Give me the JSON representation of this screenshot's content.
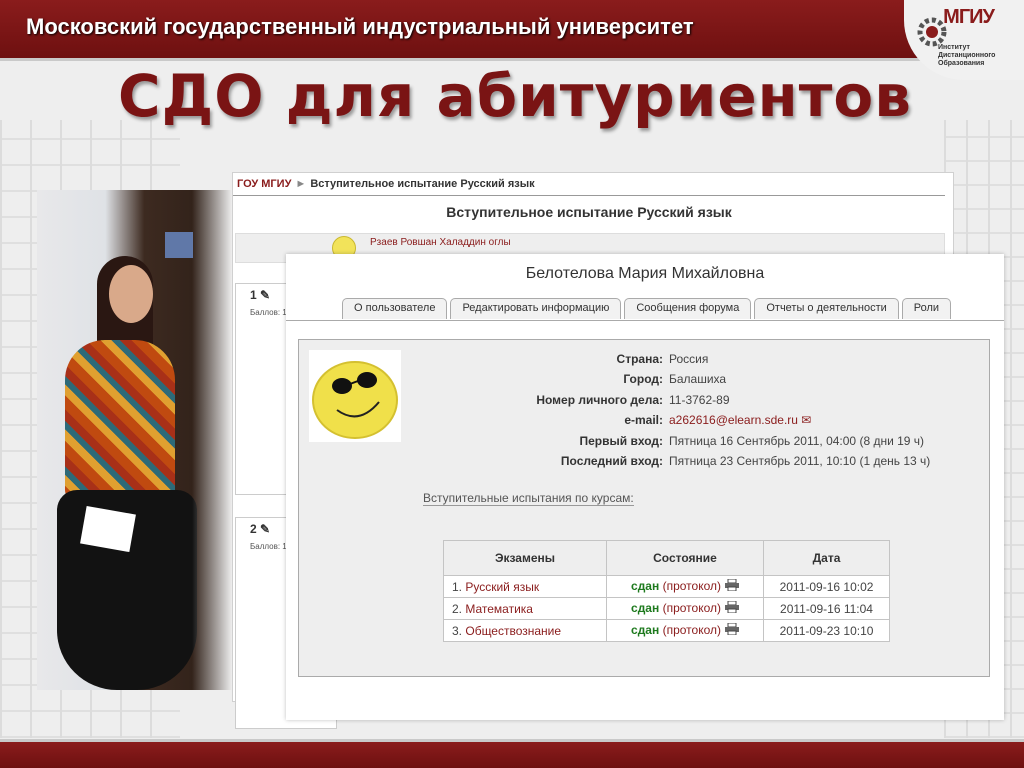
{
  "header": {
    "university": "Московский государственный индустриальный университет",
    "logo_abbr": "МГИУ",
    "logo_lines": [
      "Институт",
      "Дистанционного",
      "Образования"
    ]
  },
  "slide_title": "СДО для абитуриентов",
  "back_window": {
    "breadcrumb_root": "ГОУ МГИУ",
    "breadcrumb_sep": "►",
    "breadcrumb_current": "Вступительное испытание Русский язык",
    "title": "Вступительное испытание Русский язык",
    "student_name": "Рзаев Ровшан Халаддин оглы",
    "questions": [
      {
        "number": "1",
        "score_label": "Баллов: 1"
      },
      {
        "number": "2",
        "score_label": "Баллов: 1"
      }
    ]
  },
  "profile_window": {
    "title": "Белотелова Мария Михайловна",
    "tabs": [
      "О пользователе",
      "Редактировать информацию",
      "Сообщения форума",
      "Отчеты о деятельности",
      "Роли"
    ],
    "fields": [
      {
        "label": "Страна:",
        "value": "Россия"
      },
      {
        "label": "Город:",
        "value": "Балашиха"
      },
      {
        "label": "Номер личного дела:",
        "value": "11-3762-89"
      },
      {
        "label": "e-mail:",
        "value": "a262616@elearn.sde.ru"
      },
      {
        "label": "Первый вход:",
        "value": "Пятница 16 Сентябрь 2011, 04:00  (8 дни 19 ч)"
      },
      {
        "label": "Последний вход:",
        "value": "Пятница 23 Сентябрь 2011, 10:10  (1 день 13 ч)"
      }
    ],
    "courses_link": "Вступительные испытания по курсам:",
    "exams_table": {
      "headers": [
        "Экзамены",
        "Состояние",
        "Дата"
      ],
      "rows": [
        {
          "num": "1.",
          "course": "Русский язык",
          "status": "сдан",
          "protocol": "(протокол)",
          "date": "2011-09-16 10:02"
        },
        {
          "num": "2.",
          "course": "Математика",
          "status": "сдан",
          "protocol": "(протокол)",
          "date": "2011-09-16 11:04"
        },
        {
          "num": "3.",
          "course": "Обществознание",
          "status": "сдан",
          "protocol": "(протокол)",
          "date": "2011-09-23 10:10"
        }
      ]
    }
  }
}
